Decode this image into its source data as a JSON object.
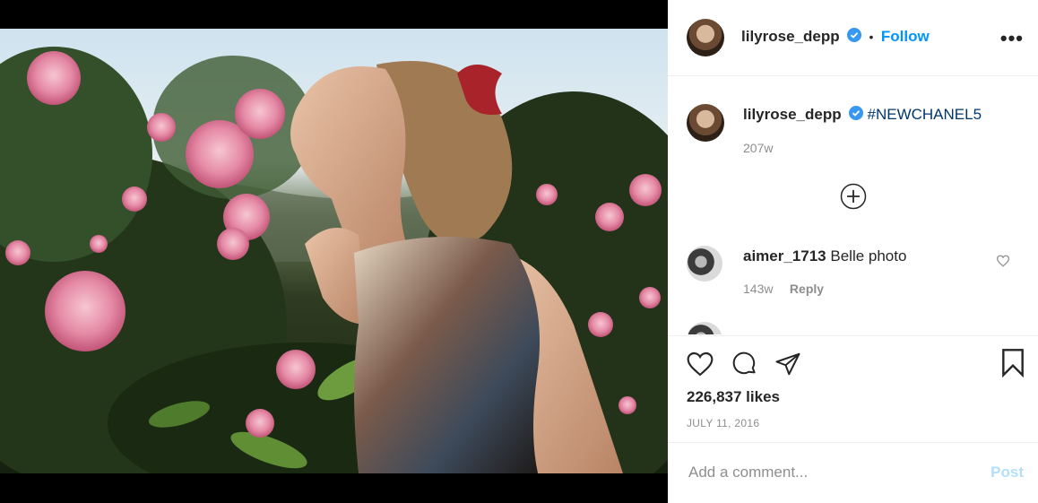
{
  "post": {
    "username": "lilyrose_depp",
    "follow_separator": "•",
    "follow_label": "Follow",
    "more_options": "•••"
  },
  "caption": {
    "username": "lilyrose_depp",
    "hashtag": "#NEWCHANEL5",
    "age": "207w"
  },
  "comments": [
    {
      "username": "aimer_1713",
      "text": "Belle photo",
      "age": "143w",
      "reply_label": "Reply"
    }
  ],
  "stats": {
    "likes": "226,837 likes",
    "date": "JULY 11, 2016"
  },
  "composer": {
    "placeholder": "Add a comment...",
    "post_label": "Post"
  },
  "icons": {
    "verified": "verified-badge-icon",
    "load_more": "plus-circle-icon",
    "like": "heart-icon",
    "comment": "comment-bubble-icon",
    "share": "paper-plane-icon",
    "save": "bookmark-icon"
  },
  "colors": {
    "accent": "#0095f6",
    "hashtag": "#00376b",
    "muted": "#8e8e8e",
    "post_disabled": "#b2dffc"
  }
}
